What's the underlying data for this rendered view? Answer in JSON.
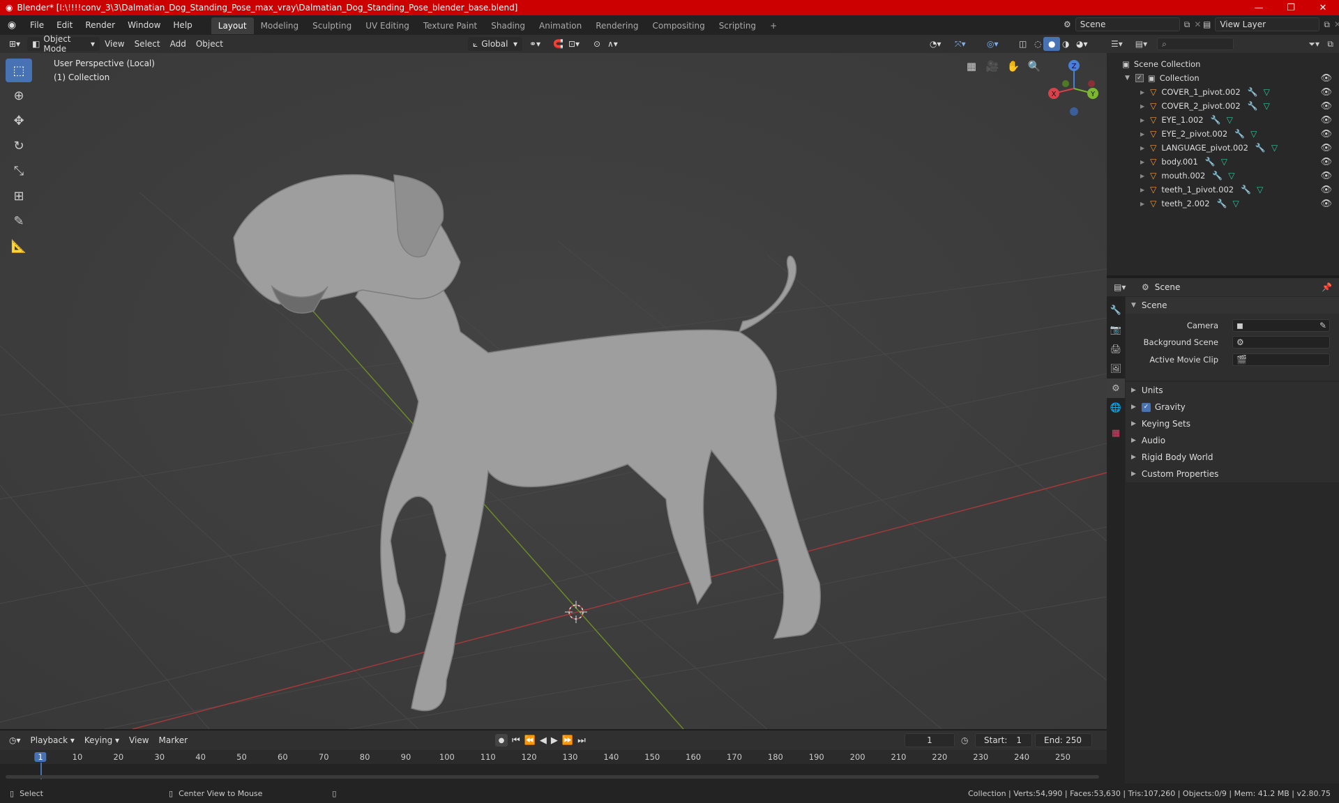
{
  "window": {
    "title": "Blender* [I:\\!!!!conv_3\\3\\Dalmatian_Dog_Standing_Pose_max_vray\\Dalmatian_Dog_Standing_Pose_blender_base.blend]",
    "minimize": "—",
    "maximize": "❐",
    "close": "✕"
  },
  "menu": {
    "items": [
      "File",
      "Edit",
      "Render",
      "Window",
      "Help"
    ]
  },
  "workspaces": {
    "tabs": [
      "Layout",
      "Modeling",
      "Sculpting",
      "UV Editing",
      "Texture Paint",
      "Shading",
      "Animation",
      "Rendering",
      "Compositing",
      "Scripting"
    ],
    "add": "+",
    "active": "Layout"
  },
  "scene_selector": {
    "value": "Scene"
  },
  "view_layer": {
    "value": "View Layer"
  },
  "viewport_header": {
    "mode": "Object Mode",
    "view": "View",
    "select": "Select",
    "add": "Add",
    "object": "Object",
    "orientation": "Global"
  },
  "viewport": {
    "perspective": "User Perspective (Local)",
    "collection": "(1) Collection",
    "gizmo": {
      "x": "X",
      "y": "Y",
      "z": "Z"
    }
  },
  "outliner": {
    "root": "Scene Collection",
    "collection": "Collection",
    "objects": [
      "COVER_1_pivot.002",
      "COVER_2_pivot.002",
      "EYE_1.002",
      "EYE_2_pivot.002",
      "LANGUAGE_pivot.002",
      "body.001",
      "mouth.002",
      "teeth_1_pivot.002",
      "teeth_2.002"
    ]
  },
  "properties": {
    "header": "Scene",
    "section": "Scene",
    "camera_label": "Camera",
    "background_label": "Background Scene",
    "movieclip_label": "Active Movie Clip",
    "panels": [
      "Units",
      "Gravity",
      "Keying Sets",
      "Audio",
      "Rigid Body World",
      "Custom Properties"
    ]
  },
  "timeline": {
    "playback": "Playback",
    "keying": "Keying",
    "view": "View",
    "marker": "Marker",
    "current_frame": "1",
    "start_label": "Start:",
    "start": "1",
    "end_label": "End:",
    "end": "250",
    "ticks": [
      "1",
      "10",
      "20",
      "30",
      "40",
      "50",
      "60",
      "70",
      "80",
      "90",
      "100",
      "110",
      "120",
      "130",
      "140",
      "150",
      "160",
      "170",
      "180",
      "190",
      "200",
      "210",
      "220",
      "230",
      "240",
      "250"
    ]
  },
  "status": {
    "select": "Select",
    "center": "Center View to Mouse",
    "stats": "Collection | Verts:54,990 | Faces:53,630 | Tris:107,260 | Objects:0/9 | Mem: 41.2 MB | v2.80.75"
  }
}
